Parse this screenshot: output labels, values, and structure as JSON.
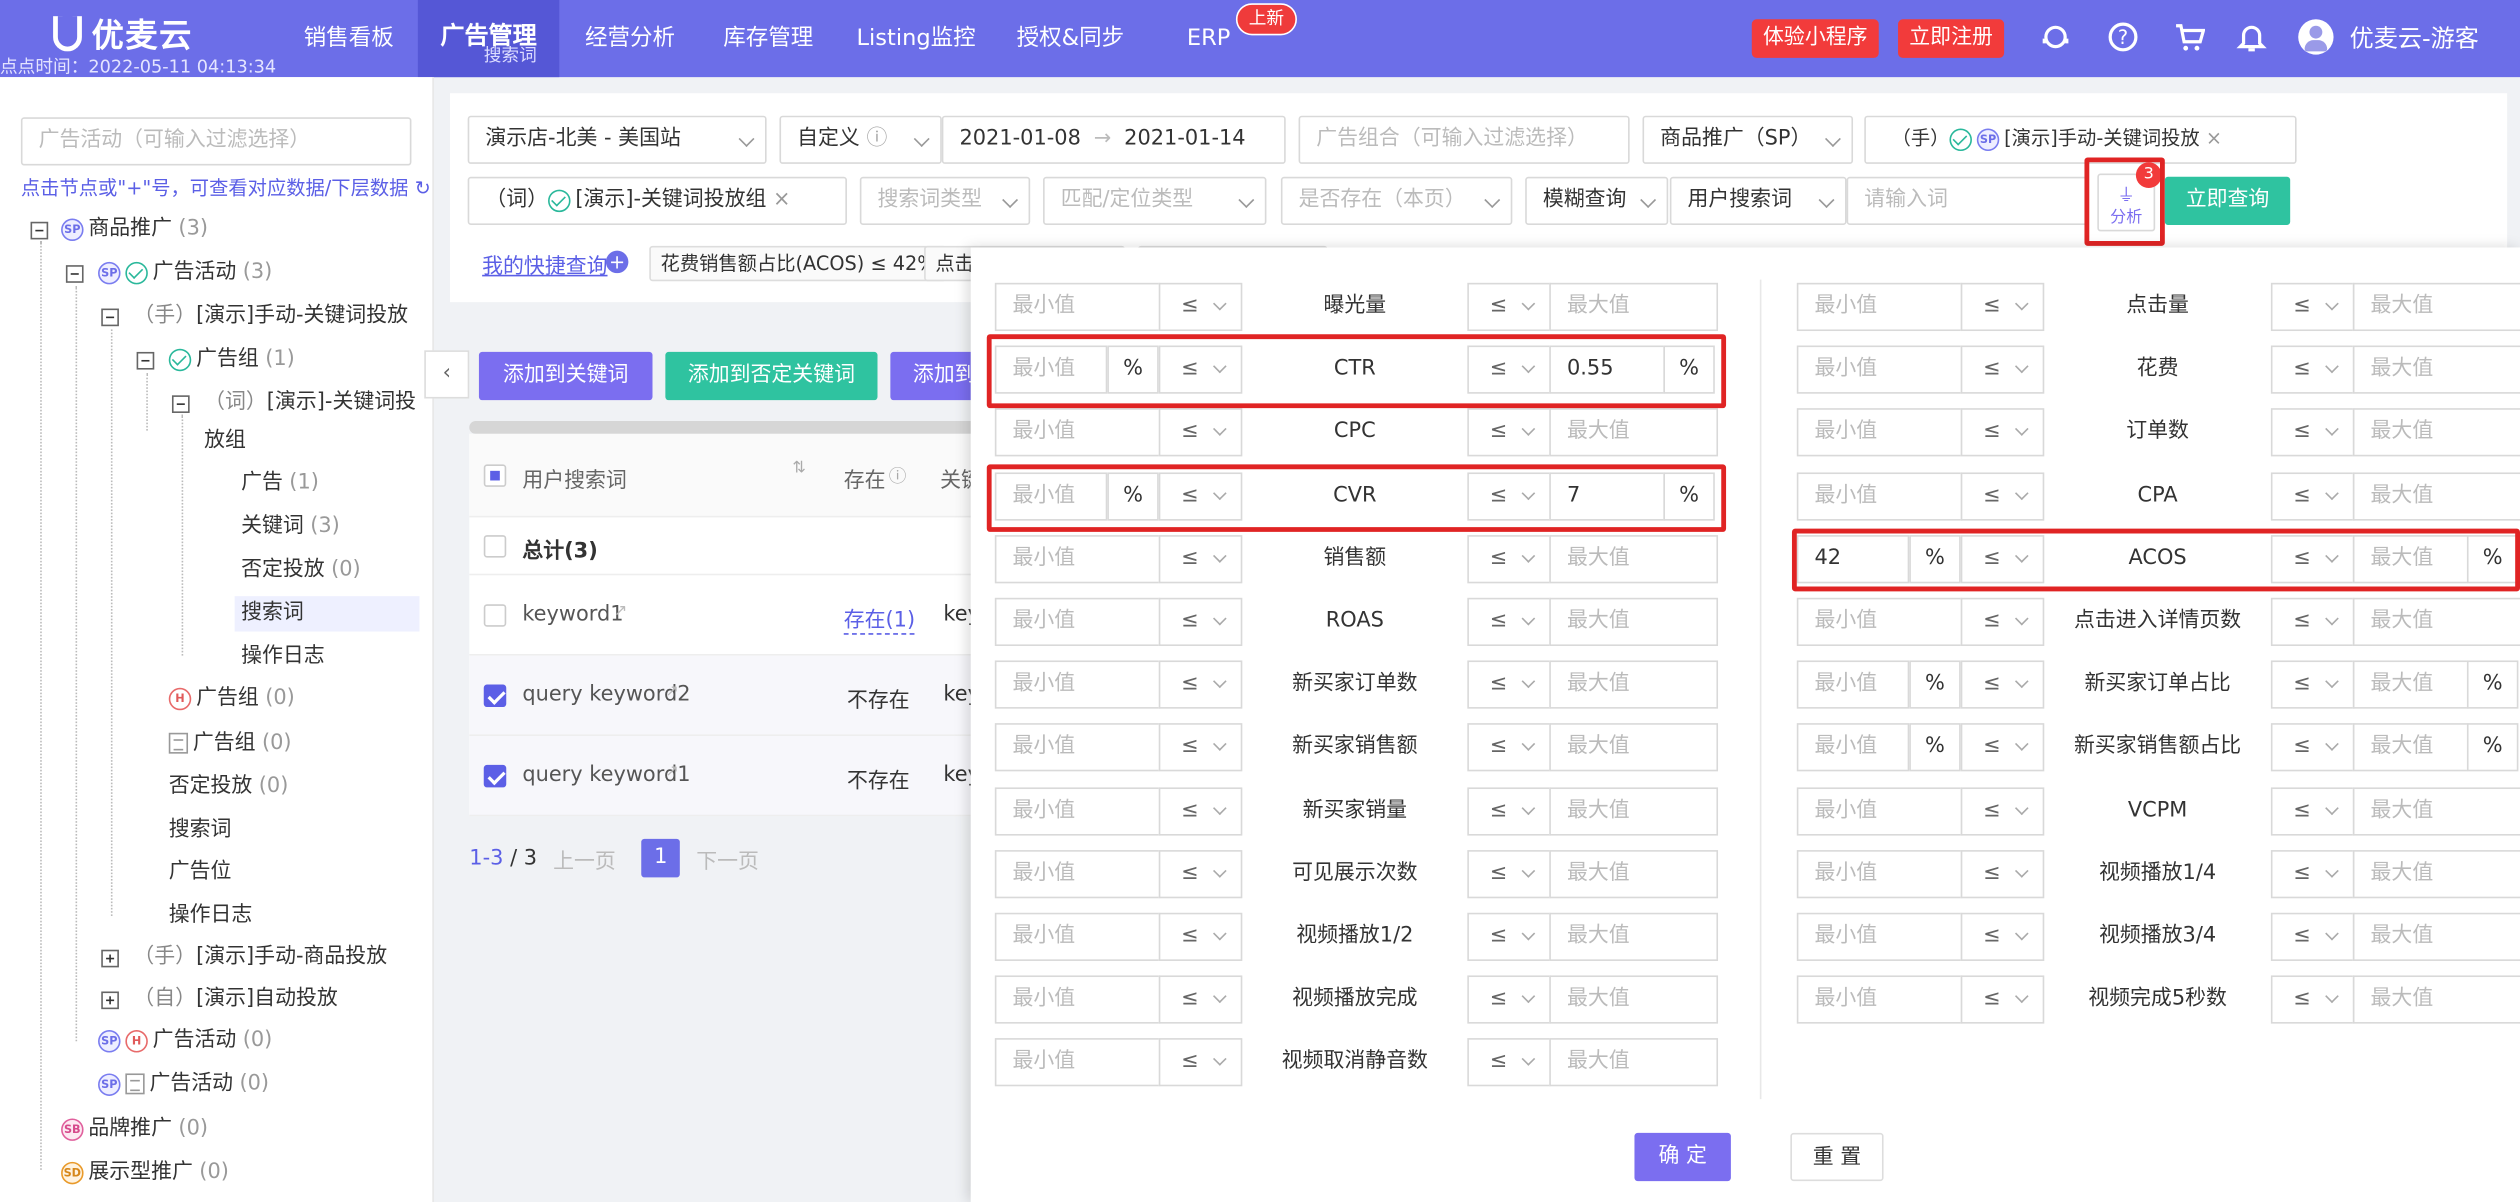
{
  "nav": {
    "logo": "优麦云",
    "timestamp": "点点时间：2022-05-11 04:13:34",
    "items": [
      "销售看板",
      "广告管理",
      "经营分析",
      "库存管理",
      "Listing监控",
      "授权&同步",
      "ERP"
    ],
    "active_sub": "搜索词",
    "new_badge": "上新",
    "miniapp": "体验小程序",
    "register": "立即注册",
    "user": "优麦云-游客"
  },
  "left": {
    "search_placeholder": "广告活动（可输入过滤选择）",
    "hint": "点击节点或\"+\"号，可查看对应数据/下层数据",
    "nodes": [
      {
        "label": "商品推广",
        "count": "(3)"
      },
      {
        "label": "广告活动",
        "count": "(3)"
      },
      {
        "prefix": "（手）",
        "label": "[演示]手动-关键词投放"
      },
      {
        "label": "广告组",
        "count": "(1)"
      },
      {
        "prefix": "（词）",
        "label": "[演示]-关键词投",
        "label2": "放组"
      },
      {
        "label": "广告",
        "count": "(1)"
      },
      {
        "label": "关键词",
        "count": "(3)"
      },
      {
        "label": "否定投放",
        "count": "(0)"
      },
      {
        "label": "搜索词"
      },
      {
        "label": "操作日志"
      },
      {
        "label": "广告组",
        "count": "(0)"
      },
      {
        "label": "广告组",
        "count": "(0)"
      },
      {
        "label": "否定投放",
        "count": "(0)"
      },
      {
        "label": "搜索词"
      },
      {
        "label": "广告位"
      },
      {
        "label": "操作日志"
      },
      {
        "prefix": "（手）",
        "label": "[演示]手动-商品投放"
      },
      {
        "prefix": "（自）",
        "label": "[演示]自动投放"
      },
      {
        "label": "广告活动",
        "count": "(0)"
      },
      {
        "label": "广告活动",
        "count": "(0)"
      },
      {
        "label": "品牌推广",
        "count": "(0)"
      },
      {
        "label": "展示型推广",
        "count": "(0)"
      }
    ]
  },
  "filters": {
    "shop": "演示店-北美 - 美国站",
    "date_mode": "自定义",
    "date_start": "2021-01-08",
    "date_end": "2021-01-14",
    "adgroup_placeholder": "广告组合（可输入过滤选择）",
    "ad_type": "商品推广（SP）",
    "campaign_tag_prefix": "（手）",
    "campaign_tag": "[演示]手动-关键词投放",
    "group_tag_prefix": "（词）",
    "group_tag": "[演示]-关键词投放组",
    "search_type_placeholder": "搜索词类型",
    "match_placeholder": "匹配/定位类型",
    "exists_placeholder": "是否存在（本页）",
    "fuzzy": "模糊查询",
    "field": "用户搜索词",
    "input_placeholder": "请输入词",
    "analysis_label": "分析",
    "analysis_badge": "3",
    "query_btn": "立即查询",
    "quick_query": "我的快捷查询",
    "quick_tag1": "花费销售额占比(ACOS) ≤ 42%",
    "quick_tag2": "点击"
  },
  "actions": {
    "add_keyword": "添加到关键词",
    "add_negative": "添加到否定关键词",
    "add_more": "添加到"
  },
  "table": {
    "columns": [
      "用户搜索词",
      "存在",
      "关键"
    ],
    "total": "总计(3)",
    "rows": [
      {
        "term": "keyword1",
        "exist": "存在(1)",
        "tail": "key",
        "checked": false
      },
      {
        "term": "query keyword2",
        "exist": "不存在",
        "tail": "key",
        "checked": true
      },
      {
        "term": "query keyword1",
        "exist": "不存在",
        "tail": "key",
        "checked": true
      }
    ],
    "pager": {
      "range": "1-3",
      "total": "/ 3",
      "prev": "上一页",
      "page": "1",
      "next": "下一页"
    }
  },
  "panel": {
    "min_ph": "最小值",
    "max_ph": "最大值",
    "op": "≤",
    "pct": "%",
    "left": [
      {
        "name": "曝光量"
      },
      {
        "name": "CTR",
        "left_pct": true,
        "max": "0.55",
        "right_pct": true
      },
      {
        "name": "CPC"
      },
      {
        "name": "CVR",
        "left_pct": true,
        "max": "7",
        "right_pct": true
      },
      {
        "name": "销售额"
      },
      {
        "name": "ROAS"
      },
      {
        "name": "新买家订单数"
      },
      {
        "name": "新买家销售额"
      },
      {
        "name": "新买家销量"
      },
      {
        "name": "可见展示次数"
      },
      {
        "name": "视频播放1/2"
      },
      {
        "name": "视频播放完成"
      },
      {
        "name": "视频取消静音数"
      }
    ],
    "right": [
      {
        "name": "点击量"
      },
      {
        "name": "花费"
      },
      {
        "name": "订单数"
      },
      {
        "name": "CPA"
      },
      {
        "name": "ACOS",
        "left_pct": true,
        "min": "42",
        "right_pct": true
      },
      {
        "name": "点击进入详情页数"
      },
      {
        "name": "新买家订单占比",
        "left_pct": true,
        "right_pct": true
      },
      {
        "name": "新买家销售额占比",
        "left_pct": true,
        "right_pct": true
      },
      {
        "name": "VCPM"
      },
      {
        "name": "视频播放1/4"
      },
      {
        "name": "视频播放3/4"
      },
      {
        "name": "视频完成5秒数"
      }
    ],
    "confirm": "确 定",
    "reset": "重 置"
  }
}
